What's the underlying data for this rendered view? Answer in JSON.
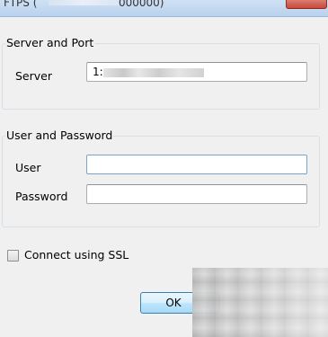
{
  "window": {
    "title_prefix": "FTPS (",
    "title_suffix": "000000)",
    "close_icon": "close-icon"
  },
  "server_group": {
    "legend": "Server and Port",
    "server_label": "Server",
    "server_value": "1:"
  },
  "user_group": {
    "legend": "User and Password",
    "user_label": "User",
    "user_value": "",
    "password_label": "Password",
    "password_value": ""
  },
  "ssl": {
    "label": "Connect using SSL",
    "checked": false
  },
  "buttons": {
    "ok": "OK"
  }
}
